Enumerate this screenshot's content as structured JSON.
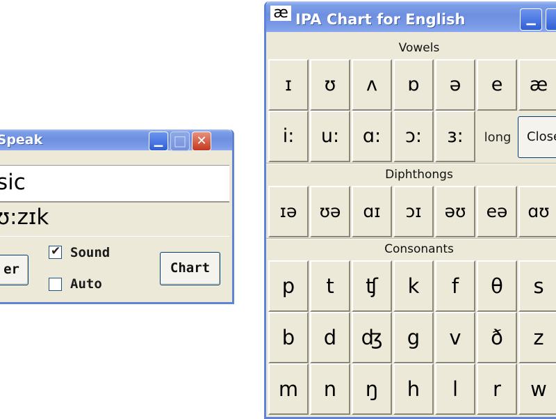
{
  "speak_window": {
    "title": "kSpeak",
    "word_value": "sic",
    "phonetic_value": "ʊ:zɪk",
    "sound_label": "Sound",
    "sound_checked": true,
    "auto_label": "Auto",
    "auto_checked": false,
    "left_button_label": "er",
    "chart_button_label": "Chart",
    "minimize_glyph": "▁",
    "maximize_glyph": "□",
    "close_glyph": "✕"
  },
  "ipa_window": {
    "title": "IPA Chart for English",
    "icon_glyph": "æ",
    "minimize_glyph": "▁",
    "vowels_heading": "Vowels",
    "vowels_row1": [
      "ɪ",
      "ʊ",
      "ʌ",
      "ɒ",
      "ə",
      "e",
      "æ"
    ],
    "vowels_row2": [
      "i:",
      "u:",
      "ɑ:",
      "ɔ:",
      "ɜ:"
    ],
    "long_label": "long",
    "close_button_label": "Close",
    "diphthongs_heading": "Diphthongs",
    "diphthongs": [
      "ɪə",
      "ʊə",
      "ɑɪ",
      "ɔɪ",
      "əʊ",
      "eə",
      "ɑʊ"
    ],
    "consonants_heading": "Consonants",
    "consonants_row1": [
      "p",
      "t",
      "ʧ",
      "k",
      "f",
      "θ",
      "s"
    ],
    "consonants_row2": [
      "b",
      "d",
      "ʤ",
      "g",
      "v",
      "ð",
      "z"
    ],
    "consonants_row3": [
      "m",
      "n",
      "ŋ",
      "h",
      "l",
      "r",
      "w"
    ]
  },
  "colors": {
    "titlebar_blue": "#6e8fe0",
    "window_border": "#5f84d7",
    "window_face": "#ece9d8",
    "close_red": "#c4381c"
  }
}
